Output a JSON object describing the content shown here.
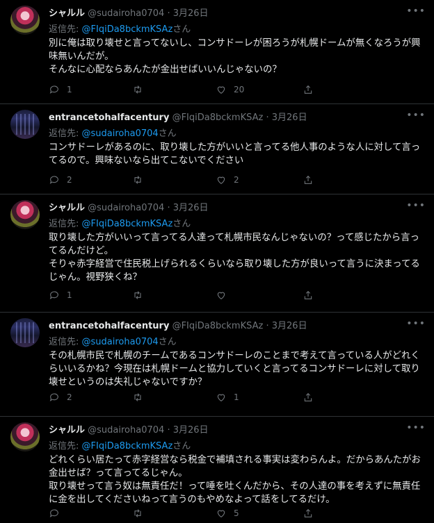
{
  "tweets": [
    {
      "name": "シャルル",
      "handle": "@sudairoha0704",
      "date": "3月26日",
      "reply_prefix": "返信先: ",
      "reply_to": "@FIqiDa8bckmKSAz",
      "reply_suffix": "さん",
      "lines": [
        "別に俺は取り壊せと言ってないし、コンサドーレが困ろうが札幌ドームが無くなろうが興味無いんだが。",
        "そんなに心配ならあんたが金出せばいいんじゃないの？"
      ],
      "replies": "1",
      "retweets": "",
      "likes": "20"
    },
    {
      "name": "entrancetohalfacentury",
      "handle": "@FIqiDa8bckmKSAz",
      "date": "3月26日",
      "reply_prefix": "返信先: ",
      "reply_to": "@sudairoha0704",
      "reply_suffix": "さん",
      "lines": [
        "コンサドーレがあるのに、取り壊した方がいいと言ってる他人事のような人に対して言ってるので。興味ないなら出てこないでください"
      ],
      "replies": "2",
      "retweets": "",
      "likes": "2"
    },
    {
      "name": "シャルル",
      "handle": "@sudairoha0704",
      "date": "3月26日",
      "reply_prefix": "返信先: ",
      "reply_to": "@FIqiDa8bckmKSAz",
      "reply_suffix": "さん",
      "lines": [
        "取り壊した方がいいって言ってる人達って札幌市民なんじゃないの？って感じたから言ってるんだけど。",
        "そりゃ赤字経営で住民税上げられるくらいなら取り壊した方が良いって言うに決まってるじゃん。視野狭くね？"
      ],
      "replies": "1",
      "retweets": "",
      "likes": ""
    },
    {
      "name": "entrancetohalfacentury",
      "handle": "@FIqiDa8bckmKSAz",
      "date": "3月26日",
      "reply_prefix": "返信先: ",
      "reply_to": "@sudairoha0704",
      "reply_suffix": "さん",
      "lines": [
        "その札幌市民で札幌のチームであるコンサドーレのことまで考えて言っている人がどれくらいいるかね？今現在は札幌ドームと協力していくと言ってるコンサドーレに対して取り壊せというのは失礼じゃないですか？"
      ],
      "replies": "2",
      "retweets": "",
      "likes": "1"
    },
    {
      "name": "シャルル",
      "handle": "@sudairoha0704",
      "date": "3月26日",
      "reply_prefix": "返信先: ",
      "reply_to": "@FIqiDa8bckmKSAz",
      "reply_suffix": "さん",
      "lines": [
        "どれくらい居たって赤字経営なら税金で補填される事実は変わらんよ。だからあんたがお金出せば？って言ってるじゃん。",
        "取り壊せって言う奴は無責任だ！って唾を吐くんだから、その人達の事を考えずに無責任に金を出してくださいねって言うのもやめなよって話をしてるだけ。"
      ],
      "replies": "",
      "retweets": "",
      "likes": "5"
    }
  ]
}
